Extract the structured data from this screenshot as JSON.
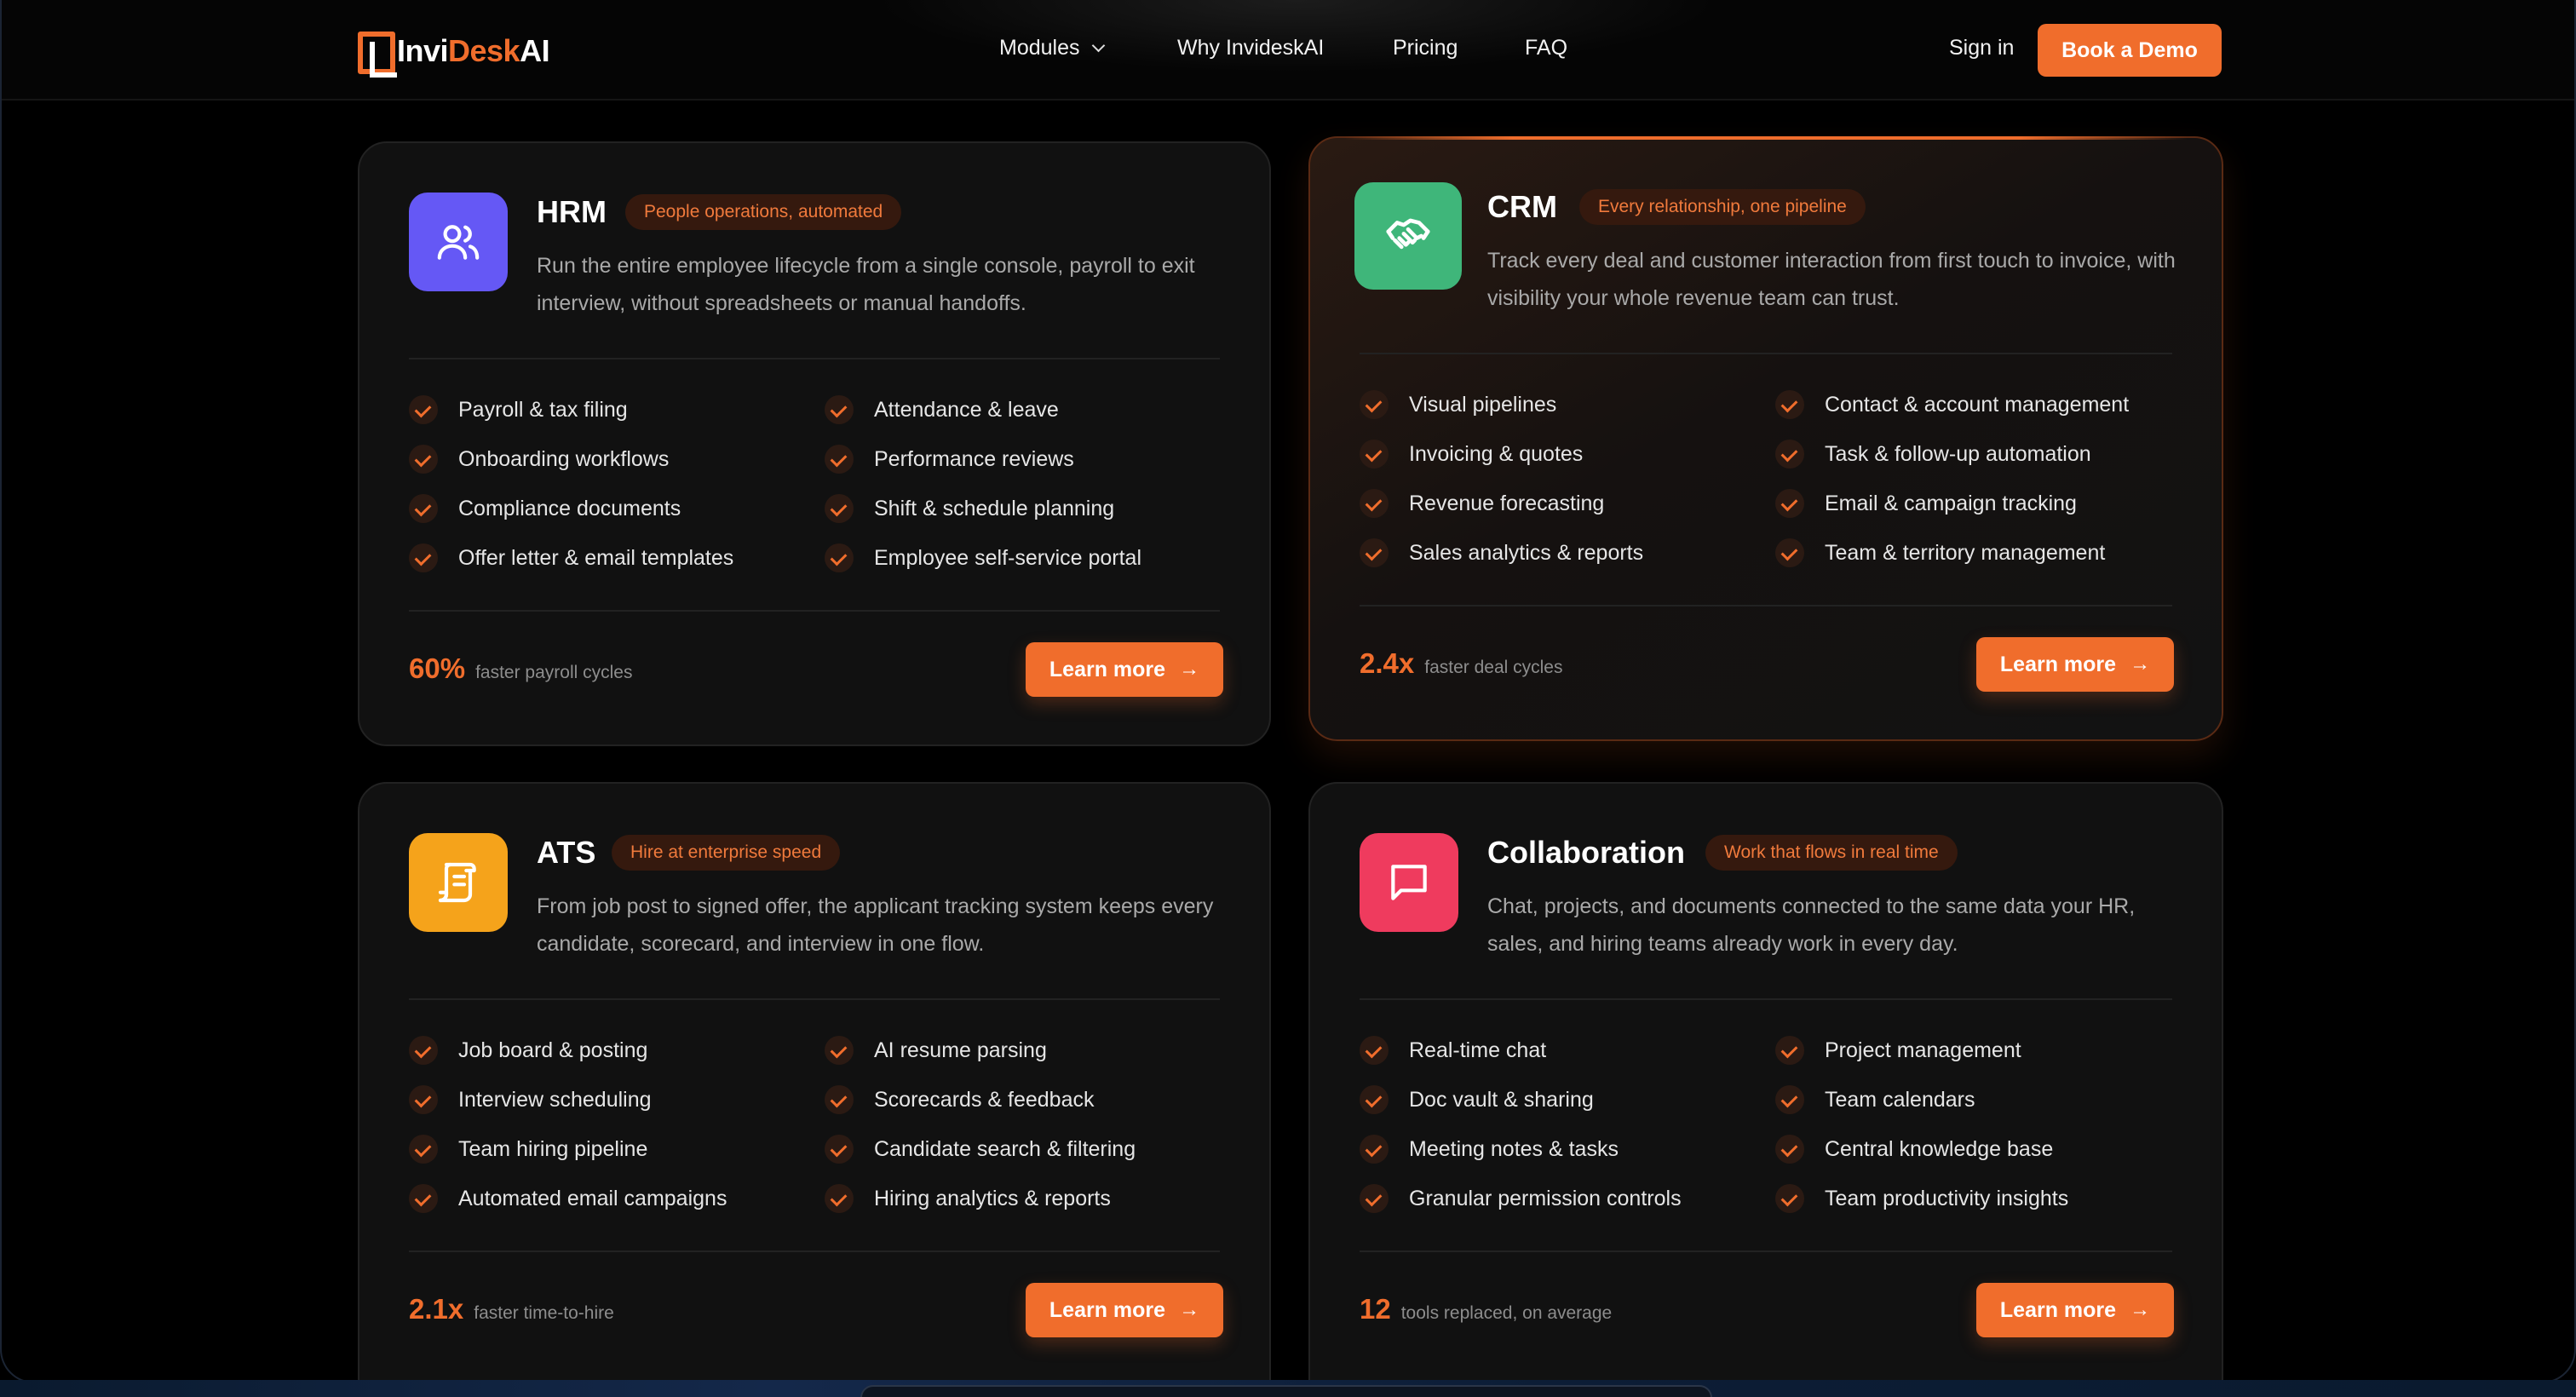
{
  "brand": {
    "logo_part1": "Invi",
    "logo_part2": "Desk",
    "logo_part3": "AI"
  },
  "colors": {
    "accent": "#f06d2c",
    "hrm": "#6558f5",
    "crm": "#3fb67a",
    "ats": "#f5a31b",
    "collab": "#ef3b5e"
  },
  "nav": {
    "modules": "Modules",
    "why": "Why InvideskAI",
    "pricing": "Pricing",
    "faq": "FAQ",
    "sign_in": "Sign in",
    "book_demo": "Book a Demo"
  },
  "cards": [
    {
      "id": "hrm",
      "title": "HRM",
      "tag": "People operations, automated",
      "icon": "users-icon",
      "desc": "Run the entire employee lifecycle from a single console, payroll to exit interview, without spreadsheets or manual handoffs.",
      "features": [
        "Payroll & tax filing",
        "Attendance & leave",
        "Onboarding workflows",
        "Performance reviews",
        "Compliance documents",
        "Shift & schedule planning",
        "Offer letter & email templates",
        "Employee self-service portal"
      ],
      "metric_value": "60%",
      "metric_label": "faster payroll cycles",
      "cta": "Learn more"
    },
    {
      "id": "crm",
      "title": "CRM",
      "tag": "Every relationship, one pipeline",
      "icon": "handshake-icon",
      "desc": "Track every deal and customer interaction from first touch to invoice, with visibility your whole revenue team can trust.",
      "features": [
        "Visual pipelines",
        "Contact & account management",
        "Invoicing & quotes",
        "Task & follow-up automation",
        "Revenue forecasting",
        "Email & campaign tracking",
        "Sales analytics & reports",
        "Team & territory management"
      ],
      "metric_value": "2.4x",
      "metric_label": "faster deal cycles",
      "cta": "Learn more"
    },
    {
      "id": "ats",
      "title": "ATS",
      "tag": "Hire at enterprise speed",
      "icon": "scroll-icon",
      "desc": "From job post to signed offer, the applicant tracking system keeps every candidate, scorecard, and interview in one flow.",
      "features": [
        "Job board & posting",
        "AI resume parsing",
        "Interview scheduling",
        "Scorecards & feedback",
        "Team hiring pipeline",
        "Candidate search & filtering",
        "Automated email campaigns",
        "Hiring analytics & reports"
      ],
      "metric_value": "2.1x",
      "metric_label": "faster time-to-hire",
      "cta": "Learn more"
    },
    {
      "id": "collab",
      "title": "Collaboration",
      "tag": "Work that flows in real time",
      "icon": "chat-icon",
      "desc": "Chat, projects, and documents connected to the same data your HR, sales, and hiring teams already work in every day.",
      "features": [
        "Real-time chat",
        "Project management",
        "Doc vault & sharing",
        "Team calendars",
        "Meeting notes & tasks",
        "Central knowledge base",
        "Granular permission controls",
        "Team productivity insights"
      ],
      "metric_value": "12",
      "metric_label": "tools replaced, on average",
      "cta": "Learn more"
    }
  ]
}
